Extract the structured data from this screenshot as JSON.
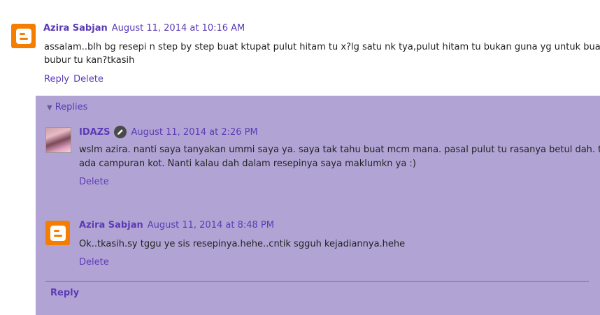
{
  "comment": {
    "author": "Azira Sabjan",
    "timestamp": "August 11, 2014 at 10:16 AM",
    "body_lines": [
      "assalam..blh bg resepi n step by step buat ktupat pulut hitam tu x?lg satu nk tya,pulut hitam tu bukan guna yg untuk buat",
      "bubur tu kan?tkasih"
    ],
    "reply_label": "Reply",
    "delete_label": "Delete",
    "avatar_icon": "blogger-icon"
  },
  "replies": {
    "toggle_label": "Replies",
    "items": [
      {
        "author": "IDAZS",
        "timestamp": "August 11, 2014 at 2:26 PM",
        "body_lines": [
          "wslm azira. nanti saya tanyakan ummi saya ya. saya tak tahu buat mcm mana. pasal pulut tu rasanya betul dah. tapi",
          "ada campuran kot. Nanti kalau dah dalam resepinya saya maklumkn ya :)"
        ],
        "delete_label": "Delete",
        "badge_icon": "pencil-icon"
      },
      {
        "author": "Azira Sabjan",
        "timestamp": "August 11, 2014 at 8:48 PM",
        "body_lines": [
          "Ok..tkasih.sy tggu ye sis resepinya.hehe..cntik sgguh kejadiannya.hehe"
        ],
        "delete_label": "Delete",
        "avatar_icon": "blogger-icon"
      }
    ],
    "reply_label": "Reply"
  },
  "colors": {
    "link": "#5b3bb5",
    "panel_bg": "#b1a4d5",
    "blogger_orange": "#f57d00"
  }
}
